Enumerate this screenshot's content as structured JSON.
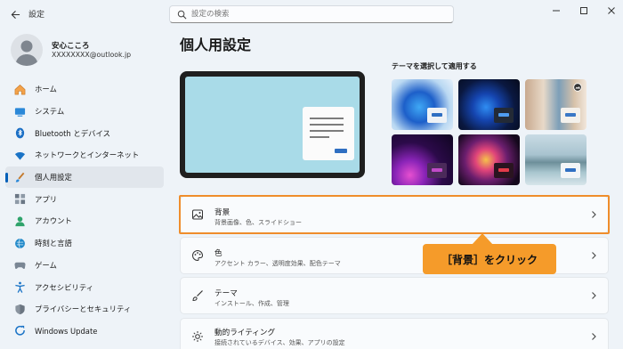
{
  "window": {
    "title": "設定",
    "search_placeholder": "設定の検索"
  },
  "profile": {
    "name": "安心こころ",
    "email": "XXXXXXXX@outlook.jp"
  },
  "sidebar": {
    "items": [
      {
        "label": "ホーム",
        "icon": "home-icon"
      },
      {
        "label": "システム",
        "icon": "system-icon"
      },
      {
        "label": "Bluetooth とデバイス",
        "icon": "bluetooth-icon"
      },
      {
        "label": "ネットワークとインターネット",
        "icon": "wifi-icon"
      },
      {
        "label": "個人用設定",
        "icon": "brush-icon",
        "selected": true
      },
      {
        "label": "アプリ",
        "icon": "apps-icon"
      },
      {
        "label": "アカウント",
        "icon": "account-icon"
      },
      {
        "label": "時刻と言語",
        "icon": "globe-clock-icon"
      },
      {
        "label": "ゲーム",
        "icon": "gamepad-icon"
      },
      {
        "label": "アクセシビリティ",
        "icon": "accessibility-icon"
      },
      {
        "label": "プライバシーとセキュリティ",
        "icon": "shield-icon"
      },
      {
        "label": "Windows Update",
        "icon": "update-icon"
      }
    ]
  },
  "main": {
    "title": "個人用設定",
    "theme_section_label": "テーマを選択して適用する",
    "settings": [
      {
        "title": "背景",
        "desc": "背景画像、色、スライドショー",
        "icon": "image-icon"
      },
      {
        "title": "色",
        "desc": "アクセント カラー、透明度効果、配色テーマ",
        "icon": "palette-icon"
      },
      {
        "title": "テーマ",
        "desc": "インストール、作成、管理",
        "icon": "brush-icon"
      },
      {
        "title": "動的ライティング",
        "desc": "接続されているデバイス、効果、アプリの設定",
        "icon": "sun-icon"
      }
    ]
  },
  "annotation": {
    "callout_text": "［背景］をクリック",
    "highlight_color": "#ef8d2b",
    "callout_color": "#f59b2a"
  },
  "colors": {
    "accent": "#005fb8",
    "window_bg": "#eef3f8",
    "card_bg": "#f9fbfd"
  }
}
